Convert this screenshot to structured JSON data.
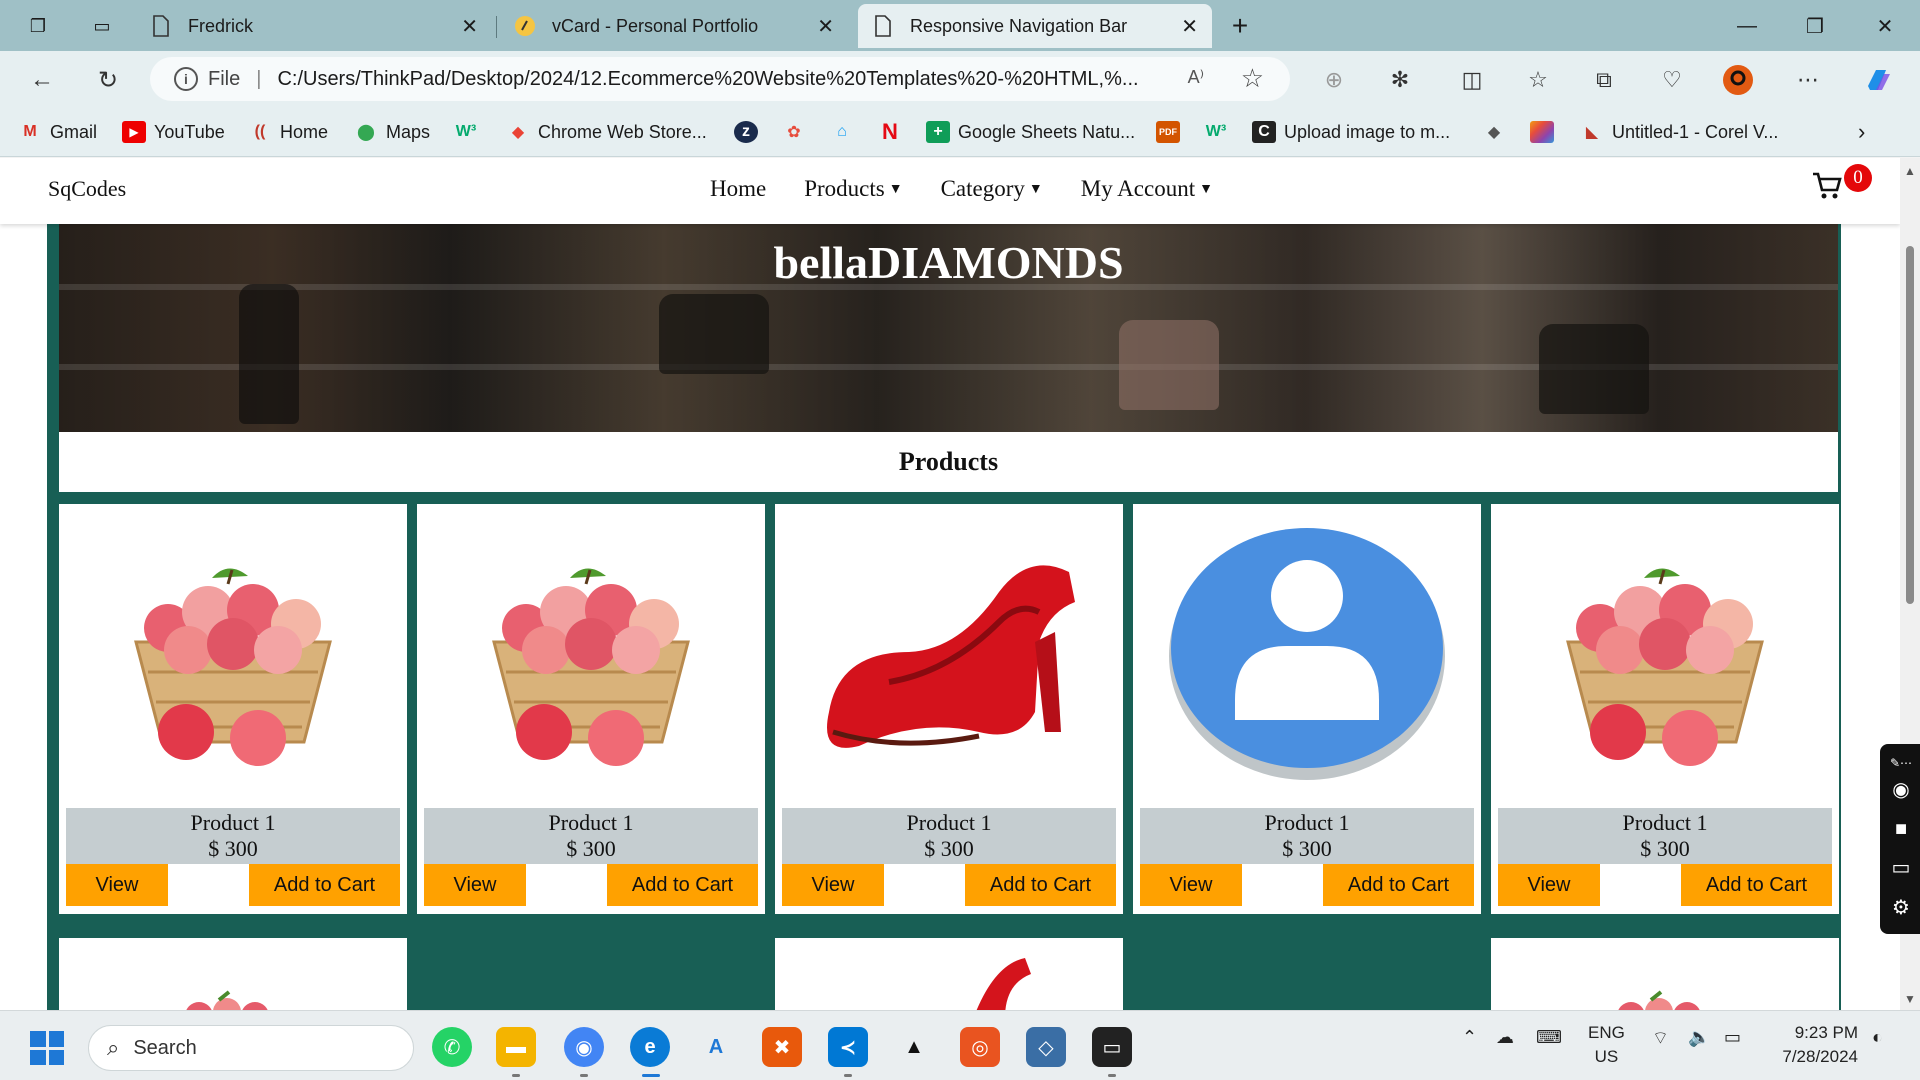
{
  "browser": {
    "tabs": [
      {
        "label": "Fredrick",
        "icon": "document-icon",
        "active": false
      },
      {
        "label": "vCard - Personal Portfolio",
        "icon": "pen-icon",
        "active": false
      },
      {
        "label": "Responsive Navigation Bar",
        "icon": "document-icon",
        "active": true
      }
    ],
    "address": {
      "scheme_label": "File",
      "url": "C:/Users/ThinkPad/Desktop/2024/12.Ecommerce%20Website%20Templates%20-%20HTML,%..."
    },
    "bookmarks": [
      {
        "label": "Gmail",
        "icon": "gmail-icon"
      },
      {
        "label": "YouTube",
        "icon": "youtube-icon"
      },
      {
        "label": "Home",
        "icon": "home-icon"
      },
      {
        "label": "Maps",
        "icon": "maps-icon"
      },
      {
        "label": "",
        "icon": "w3-icon"
      },
      {
        "label": "Chrome Web Store...",
        "icon": "chrome-store-icon"
      },
      {
        "label": "",
        "icon": "bookmark-icon"
      },
      {
        "label": "",
        "icon": "bookmark-icon"
      },
      {
        "label": "",
        "icon": "bookmark-icon"
      },
      {
        "label": "",
        "icon": "netflix-icon"
      },
      {
        "label": "Google Sheets Natu...",
        "icon": "sheets-icon"
      },
      {
        "label": "",
        "icon": "pdf-icon"
      },
      {
        "label": "",
        "icon": "w3-icon"
      },
      {
        "label": "Upload image to m...",
        "icon": "upload-icon"
      },
      {
        "label": "",
        "icon": "bookmark-icon"
      },
      {
        "label": "",
        "icon": "bookmark-icon"
      },
      {
        "label": "Untitled-1 - Corel V...",
        "icon": "corel-icon"
      }
    ]
  },
  "site": {
    "brand": "SqCodes",
    "menu": [
      {
        "label": "Home",
        "dropdown": false
      },
      {
        "label": "Products",
        "dropdown": true
      },
      {
        "label": "Category",
        "dropdown": true
      },
      {
        "label": "My Account",
        "dropdown": true
      }
    ],
    "cart_count": "0",
    "hero_title": "bellaDIAMONDS",
    "section_title": "Products",
    "colors": {
      "background": "#185f55",
      "button": "#ffa100",
      "badge": "#e4080a",
      "info_bg": "#c5cdd0"
    }
  },
  "products": [
    {
      "name": "Product 1",
      "price": "$ 300",
      "image": "apple-basket",
      "view_label": "View",
      "cart_label": "Add to Cart"
    },
    {
      "name": "Product 1",
      "price": "$ 300",
      "image": "apple-basket",
      "view_label": "View",
      "cart_label": "Add to Cart"
    },
    {
      "name": "Product 1",
      "price": "$ 300",
      "image": "red-shoe",
      "view_label": "View",
      "cart_label": "Add to Cart"
    },
    {
      "name": "Product 1",
      "price": "$ 300",
      "image": "user-avatar",
      "view_label": "View",
      "cart_label": "Add to Cart"
    },
    {
      "name": "Product 1",
      "price": "$ 300",
      "image": "apple-basket",
      "view_label": "View",
      "cart_label": "Add to Cart"
    }
  ],
  "taskbar": {
    "search_placeholder": "Search",
    "language": "ENG",
    "region": "US",
    "time": "9:23 PM",
    "date": "7/28/2024"
  }
}
